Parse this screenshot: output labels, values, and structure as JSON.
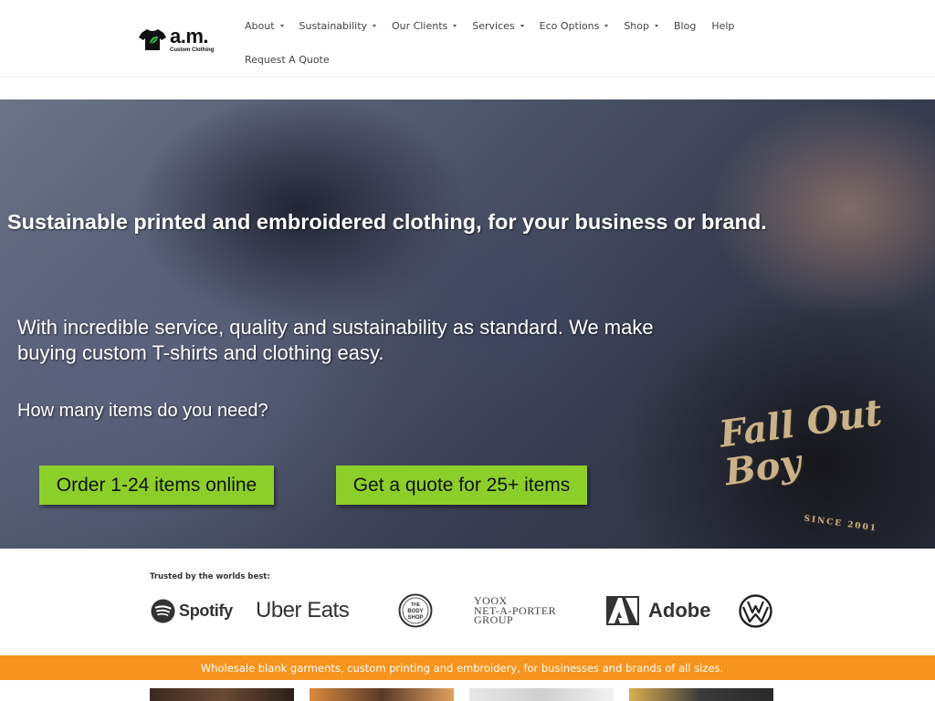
{
  "brand": {
    "logo_main": "a.m.",
    "logo_sub": "Custom Clothing"
  },
  "nav": {
    "items": [
      {
        "label": "About",
        "dropdown": true
      },
      {
        "label": "Sustainability",
        "dropdown": true
      },
      {
        "label": "Our Clients",
        "dropdown": true
      },
      {
        "label": "Services",
        "dropdown": true
      },
      {
        "label": "Eco Options",
        "dropdown": true
      },
      {
        "label": "Shop",
        "dropdown": true
      },
      {
        "label": "Blog",
        "dropdown": false
      },
      {
        "label": "Help",
        "dropdown": false
      },
      {
        "label": "Request A Quote",
        "dropdown": false
      }
    ]
  },
  "hero": {
    "title": "Sustainable printed and embroidered clothing, for your business or brand.",
    "subtitle": "With incredible service, quality and sustainability as standard. We make buying custom T-shirts and clothing easy.",
    "question": "How many items do you need?",
    "button_online": "Order 1-24 items online",
    "button_quote": "Get a quote for 25+ items",
    "shirt_print": "Fall Out Boy",
    "shirt_small": "SINCE 2001"
  },
  "trusted": {
    "label": "Trusted by the worlds best:",
    "logos": {
      "spotify": "Spotify",
      "ubereats": "Uber Eats",
      "bodyshop": "THE BODY SHOP",
      "yoox_line1": "YOOX",
      "yoox_line2": "NET-A-PORTER",
      "yoox_line3": "GROUP",
      "adobe": "Adobe",
      "vw": "VW"
    }
  },
  "banner": {
    "text": "Wholesale blank garments, custom printing and embroidery, for businesses and brands of all sizes."
  },
  "colors": {
    "accent_green": "#8ccf2a",
    "banner_orange": "#f7941d",
    "logo_leaf": "#3bb54a"
  }
}
